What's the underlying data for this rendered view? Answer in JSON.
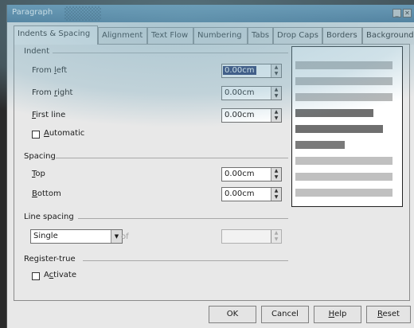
{
  "window": {
    "title": "Paragraph"
  },
  "tabs": [
    {
      "label": "Indents & Spacing",
      "active": true
    },
    {
      "label": "Alignment"
    },
    {
      "label": "Text Flow"
    },
    {
      "label": "Numbering"
    },
    {
      "label": "Tabs"
    },
    {
      "label": "Drop Caps"
    },
    {
      "label": "Borders"
    },
    {
      "label": "Background"
    }
  ],
  "indent": {
    "heading": "Indent",
    "from_left": {
      "label_pre": "From ",
      "label_u": "l",
      "label_post": "eft",
      "value": "0.00cm"
    },
    "from_right": {
      "label_pre": "From ",
      "label_u": "r",
      "label_post": "ight",
      "value": "0.00cm"
    },
    "first_line": {
      "label_pre": "",
      "label_u": "F",
      "label_post": "irst line",
      "value": "0.00cm"
    },
    "automatic": {
      "label_u": "A",
      "label_post": "utomatic"
    }
  },
  "spacing": {
    "heading": "Spacing",
    "top": {
      "label_u": "T",
      "label_post": "op",
      "value": "0.00cm"
    },
    "bottom": {
      "label_u": "B",
      "label_post": "ottom",
      "value": "0.00cm"
    }
  },
  "line_spacing": {
    "heading": "Line spacing",
    "selected": "Single",
    "of_label": "of"
  },
  "register_true": {
    "heading": "Register-true",
    "activate": {
      "label_pre": "A",
      "label_u": "c",
      "label_post": "tivate"
    }
  },
  "buttons": {
    "ok": "OK",
    "cancel": "Cancel",
    "help_u": "H",
    "help_post": "elp",
    "reset_u": "R",
    "reset_post": "eset"
  },
  "colors": {
    "titlebar": "#4a7a9d",
    "selection": "#1e2e66",
    "preview_text": "#b0b0b0",
    "preview_current": "#7a7a7a"
  },
  "icons": {
    "spin": "spin-arrows-icon",
    "dropdown": "chevron-down-icon",
    "minimize": "minimize-icon",
    "close": "close-icon"
  }
}
